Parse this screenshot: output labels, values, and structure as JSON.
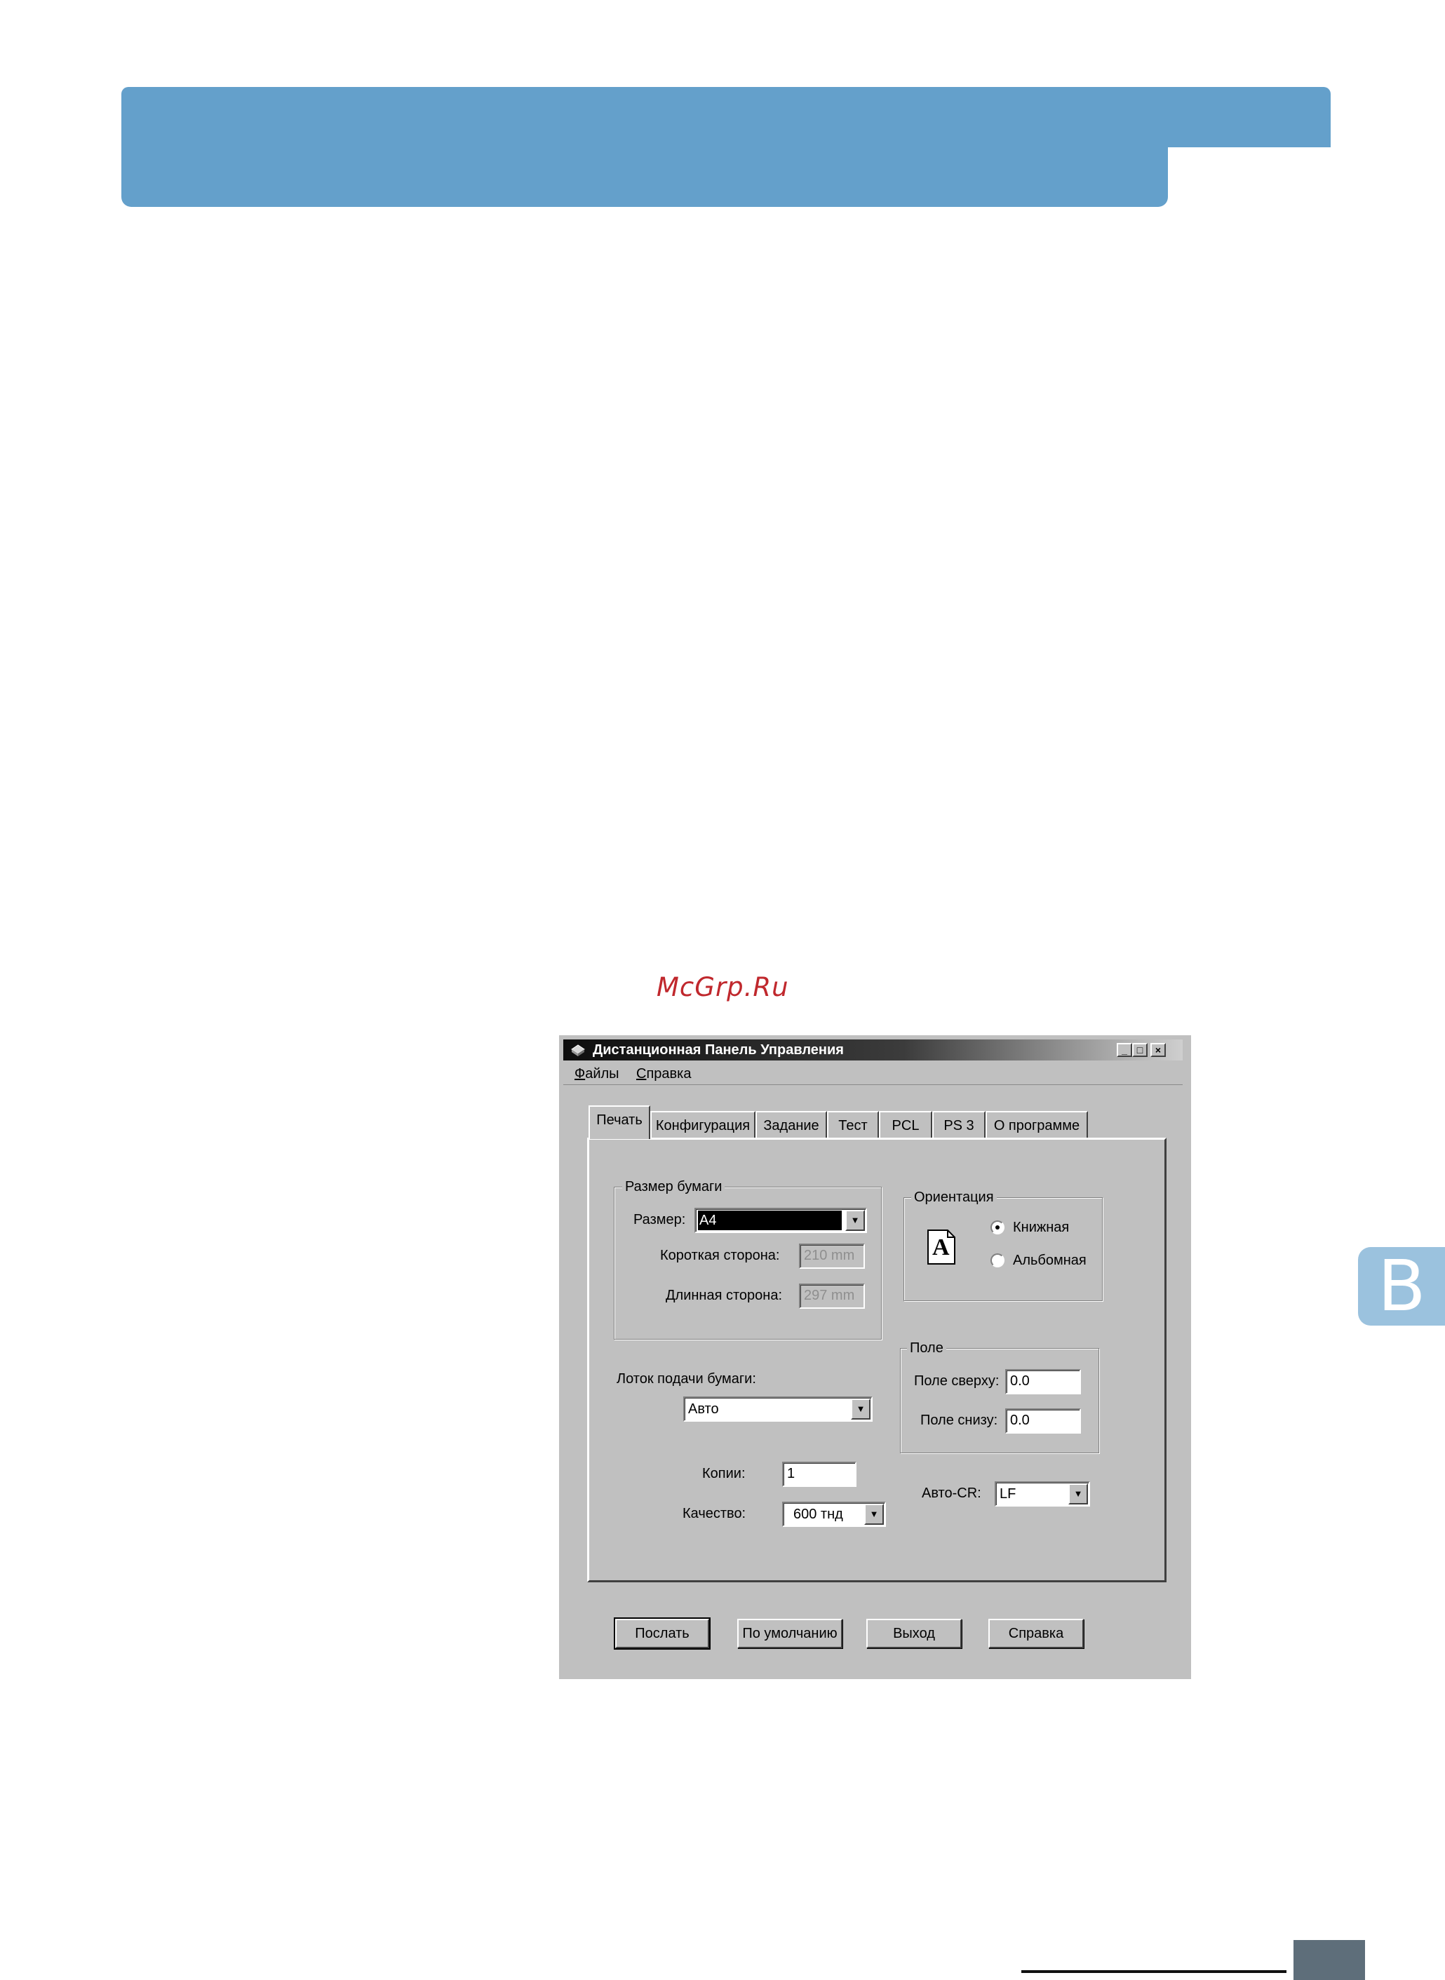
{
  "watermark": "McGrp.Ru",
  "side_tab_letter": "B",
  "dialog": {
    "title": "Дистанционная Панель Управления",
    "title_buttons": {
      "minimize": "_",
      "maximize": "□",
      "close": "×"
    },
    "menu": [
      "Файлы",
      "Справка"
    ],
    "tabs": [
      "Печать",
      "Конфигурация",
      "Задание",
      "Тест",
      "PCL",
      "PS 3",
      "О программе"
    ],
    "active_tab": "Печать",
    "paper_size": {
      "group_label": "Размер бумаги",
      "size_label": "Размер:",
      "size_value": "A4",
      "short_side_label": "Короткая сторона:",
      "short_side_value": "210 mm",
      "long_side_label": "Длинная сторона:",
      "long_side_value": "297 mm"
    },
    "orientation": {
      "group_label": "Ориентация",
      "icon_letter": "A",
      "options": [
        "Книжная",
        "Альбомная"
      ],
      "selected": "Книжная"
    },
    "tray": {
      "label": "Лоток подачи бумаги:",
      "value": "Авто"
    },
    "margins": {
      "group_label": "Поле",
      "top_label": "Поле сверху:",
      "top_value": "0.0",
      "bottom_label": "Поле снизу:",
      "bottom_value": "0.0"
    },
    "copies": {
      "label": "Копии:",
      "value": "1"
    },
    "quality": {
      "label": "Качество:",
      "value": "600 тнд"
    },
    "auto_cr": {
      "label": "Авто-CR:",
      "value": "LF"
    },
    "buttons": [
      "Послать",
      "По умолчанию",
      "Выход",
      "Справка"
    ]
  }
}
